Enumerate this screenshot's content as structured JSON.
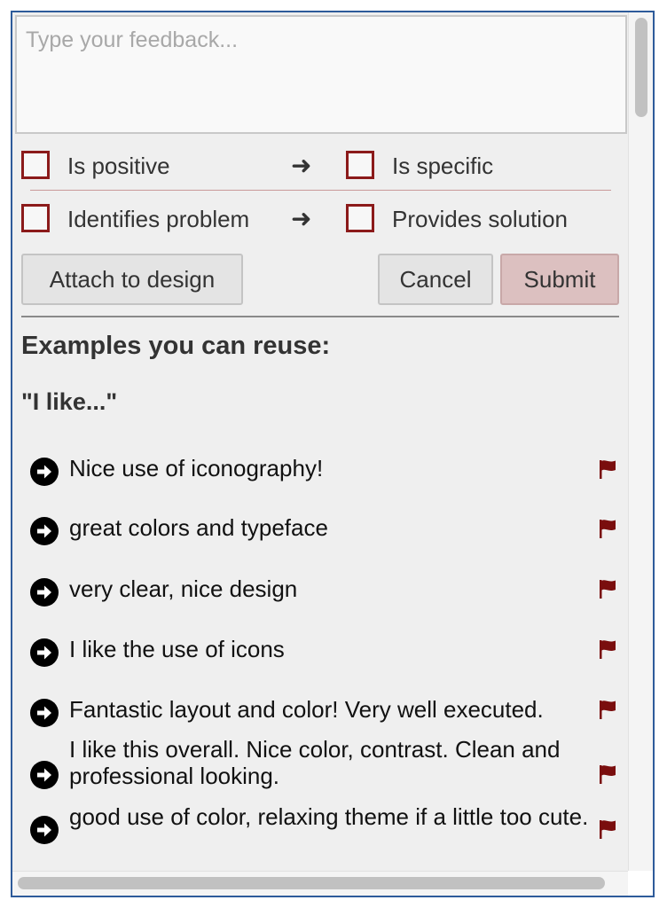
{
  "feedback": {
    "placeholder": "Type your feedback...",
    "value": ""
  },
  "checks": [
    {
      "left": "Is positive",
      "right": "Is specific"
    },
    {
      "left": "Identifies problem",
      "right": "Provides solution"
    }
  ],
  "buttons": {
    "attach": "Attach to design",
    "cancel": "Cancel",
    "submit": "Submit"
  },
  "examples": {
    "heading": "Examples you can reuse:",
    "group_title": "\"I like...\"",
    "items": [
      "Nice use of iconography!",
      "great colors and typeface",
      "very clear, nice design",
      "I like the use of icons",
      "Fantastic layout and color! Very well executed.",
      "I like this overall. Nice color, contrast. Clean and professional looking.",
      "good use of color, relaxing theme if a little too cute."
    ]
  },
  "colors": {
    "accent": "#8b1a1a",
    "frame": "#2e5b9a",
    "submit_bg": "#dcc0c0"
  },
  "icons": {
    "example_arrow": "circle-arrow-right-icon",
    "flag": "flag-icon",
    "row_arrow": "arrow-right-icon"
  }
}
